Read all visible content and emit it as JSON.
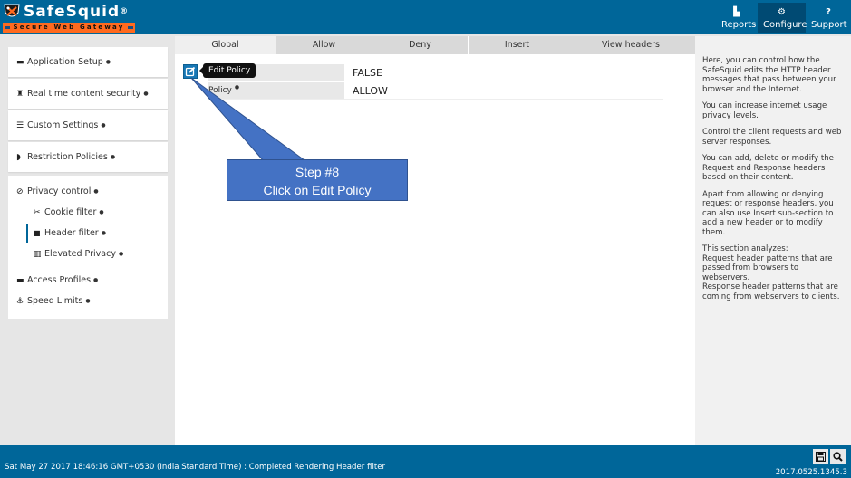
{
  "brand": {
    "name": "SafeSquid",
    "registered": "®",
    "tagline": "Secure Web Gateway"
  },
  "nav": [
    {
      "label": "Reports",
      "icon": "chart-area-icon",
      "glyph": "▙"
    },
    {
      "label": "Configure",
      "icon": "cogs-icon",
      "glyph": "⚙",
      "active": true
    },
    {
      "label": "Support",
      "icon": "question-circle-icon",
      "glyph": "?"
    }
  ],
  "sidebar": {
    "cards": [
      {
        "label": "Application Setup",
        "glyph": "▬"
      },
      {
        "label": "Real time content security",
        "glyph": "♜"
      },
      {
        "label": "Custom Settings",
        "glyph": "☰"
      },
      {
        "label": "Restriction Policies",
        "glyph": "◗"
      }
    ],
    "group": {
      "label": "Privacy control",
      "glyph": "⊘",
      "children": [
        {
          "label": "Cookie filter",
          "glyph": "✂"
        },
        {
          "label": "Header filter",
          "glyph": "🔒",
          "active": true
        },
        {
          "label": "Elevated Privacy",
          "glyph": "▥"
        }
      ],
      "after": [
        {
          "label": "Access Profiles",
          "glyph": "▬"
        },
        {
          "label": "Speed Limits",
          "glyph": "⚓"
        }
      ]
    },
    "info_glyph": "●"
  },
  "main": {
    "tabs": [
      {
        "label": "Global",
        "active": true
      },
      {
        "label": "Allow"
      },
      {
        "label": "Deny"
      },
      {
        "label": "Insert"
      },
      {
        "label": "View headers"
      }
    ],
    "rows": [
      {
        "key": "",
        "value": "FALSE"
      },
      {
        "key": "Policy",
        "value": "ALLOW"
      }
    ],
    "edit_tooltip": "Edit Policy"
  },
  "callout": {
    "line1": "Step #8",
    "line2": "Click on Edit Policy",
    "color": "#4472c4"
  },
  "help": {
    "paragraphs": [
      "Here, you can control how the SafeSquid edits the HTTP header messages that pass between your browser and the Internet.",
      "You can increase internet usage privacy levels.",
      "Control the client requests and web server responses.",
      "You can add, delete or modify the Request and Response headers based on their content.",
      "Apart from allowing or denying request or response headers, you can also use Insert sub-section to add a new header or to modify them."
    ],
    "analyzes": {
      "title": "This section analyzes:",
      "line1": "Request header patterns that are passed from browsers to webservers.",
      "line2": "Response header patterns that are coming from webservers to clients."
    }
  },
  "footer": {
    "status": "Sat May 27 2017 18:46:16 GMT+0530 (India Standard Time) : Completed Rendering Header filter",
    "version": "2017.0525.1345.3",
    "save_glyph": "💾",
    "search_glyph": "🔍"
  },
  "colors": {
    "primary": "#006699",
    "accent": "#ff6a1f",
    "callout": "#4472c4"
  }
}
